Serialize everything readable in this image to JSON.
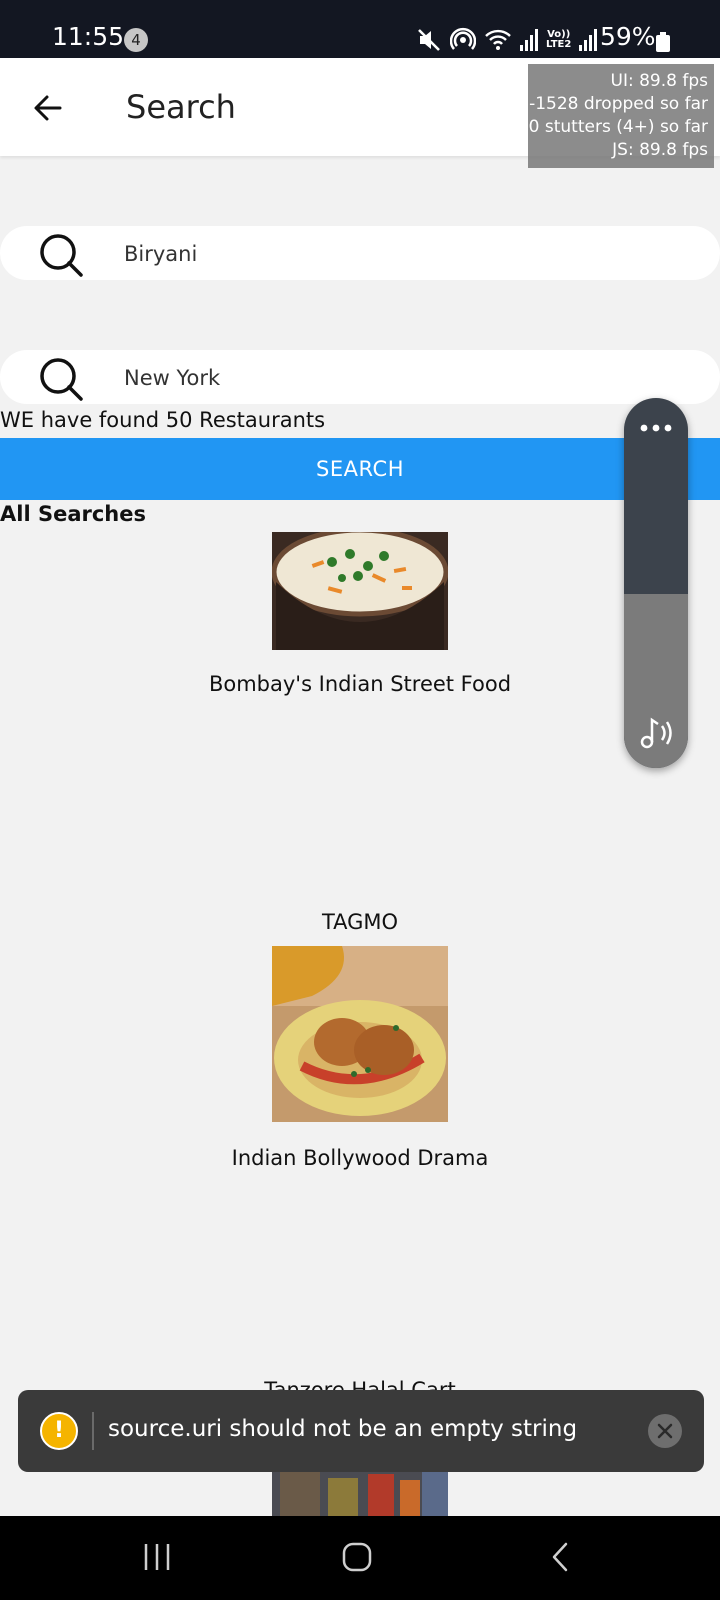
{
  "status_bar": {
    "time": "11:55",
    "notification_count": "4",
    "volte_label_top": "Vo))",
    "volte_label_bottom": "LTE2",
    "battery": "59%",
    "icons": [
      "mute-icon",
      "hotspot-icon",
      "wifi-icon",
      "signal-icon",
      "volte-icon",
      "signal-icon",
      "battery-icon"
    ]
  },
  "app_bar": {
    "title": "Search",
    "back_icon": "arrow-left-icon"
  },
  "fps_overlay": {
    "line1": "UI: 89.8 fps",
    "line2": "-1528 dropped so far",
    "line3": "0 stutters (4+) so far",
    "line4": "JS: 89.8 fps"
  },
  "search": {
    "query_value": "Biryani",
    "location_value": "New York",
    "results_text": "WE have found 50 Restaurants",
    "button_label": "SEARCH",
    "section_title": "All Searches"
  },
  "restaurants": [
    {
      "name": "Bombay's Indian Street Food",
      "image": "biryani-pot-photo"
    },
    {
      "name": "TAGMO",
      "image": "none"
    },
    {
      "name": "Indian Bollywood Drama",
      "image": "croquettes-plate-photo"
    },
    {
      "name": "Tanzore Halal Cart",
      "image": "street-cart-photo"
    }
  ],
  "volume_panel": {
    "icons": [
      "more-dots-icon",
      "music-note-icon"
    ],
    "level": 0.47
  },
  "toast": {
    "message": "source.uri should not be an empty string",
    "icons": [
      "warning-icon",
      "close-icon"
    ]
  },
  "nav_bar": {
    "icons": [
      "recents-icon",
      "home-icon",
      "back-icon"
    ]
  },
  "colors": {
    "status_bar": "#131722",
    "accent": "#2196f3",
    "background": "#f2f2f2",
    "toast": "#3a3a3a",
    "warning": "#f5b400"
  }
}
